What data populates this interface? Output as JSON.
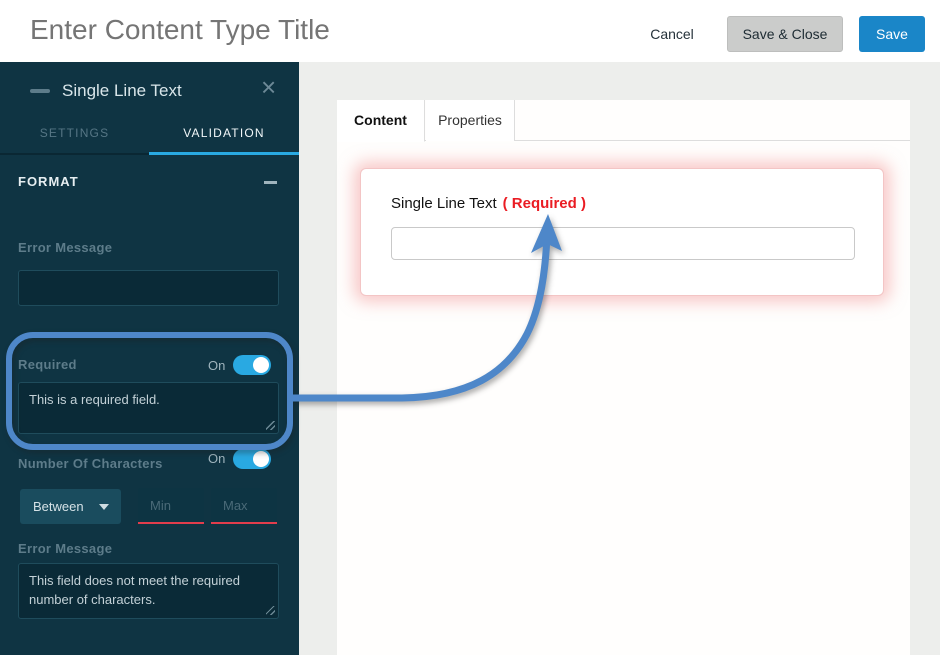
{
  "header": {
    "title_placeholder": "Enter Content Type Title",
    "cancel_label": "Cancel",
    "save_close_label": "Save & Close",
    "save_label": "Save"
  },
  "sidebar": {
    "title": "Single Line Text",
    "close_icon_glyph": "×",
    "tabs": [
      {
        "label": "SETTINGS"
      },
      {
        "label": "VALIDATION"
      }
    ],
    "active_tab": "VALIDATION",
    "format_section_label": "FORMAT",
    "format_error": {
      "label": "Error Message",
      "value": ""
    },
    "required": {
      "label": "Required",
      "state": "On",
      "message": "This is a required field."
    },
    "num_chars": {
      "label": "Number Of Characters",
      "state": "On",
      "operator": "Between",
      "min_placeholder": "Min",
      "max_placeholder": "Max",
      "error_label": "Error Message",
      "error_value": "This field does not meet the required number of characters."
    }
  },
  "main": {
    "tabs": [
      {
        "label": "Content"
      },
      {
        "label": "Properties"
      }
    ],
    "active_tab": "Content",
    "field": {
      "label": "Single Line Text",
      "required_note": "( Required )",
      "value": ""
    }
  },
  "colors": {
    "accent_blue": "#29a9e2",
    "save_blue": "#1a86c8",
    "annotation_blue": "#4e87c9",
    "required_red": "#ea1c23",
    "error_underline_red": "#e23d4c",
    "sidebar_bg": "#0f3443",
    "red_glow": "#f29494"
  }
}
